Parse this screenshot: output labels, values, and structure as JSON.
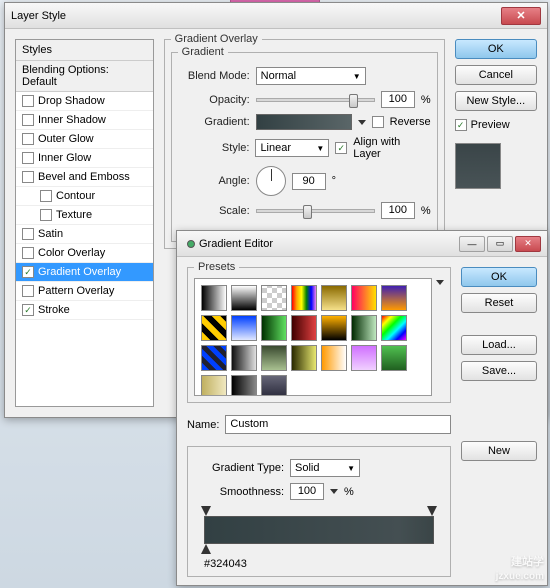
{
  "layerStyle": {
    "title": "Layer Style",
    "stylesHeader": "Styles",
    "blendingHeader": "Blending Options: Default",
    "items": [
      {
        "label": "Drop Shadow",
        "checked": false,
        "sub": false
      },
      {
        "label": "Inner Shadow",
        "checked": false,
        "sub": false
      },
      {
        "label": "Outer Glow",
        "checked": false,
        "sub": false
      },
      {
        "label": "Inner Glow",
        "checked": false,
        "sub": false
      },
      {
        "label": "Bevel and Emboss",
        "checked": false,
        "sub": false
      },
      {
        "label": "Contour",
        "checked": false,
        "sub": true
      },
      {
        "label": "Texture",
        "checked": false,
        "sub": true
      },
      {
        "label": "Satin",
        "checked": false,
        "sub": false
      },
      {
        "label": "Color Overlay",
        "checked": false,
        "sub": false
      },
      {
        "label": "Gradient Overlay",
        "checked": true,
        "sub": false,
        "selected": true
      },
      {
        "label": "Pattern Overlay",
        "checked": false,
        "sub": false
      },
      {
        "label": "Stroke",
        "checked": true,
        "sub": false
      }
    ],
    "buttons": {
      "ok": "OK",
      "cancel": "Cancel",
      "newStyle": "New Style...",
      "preview": "Preview"
    },
    "gradientOverlay": {
      "groupLabel": "Gradient Overlay",
      "subLabel": "Gradient",
      "blendModeLabel": "Blend Mode:",
      "blendMode": "Normal",
      "opacityLabel": "Opacity:",
      "opacity": "100",
      "opacityUnit": "%",
      "gradientLabel": "Gradient:",
      "reverse": "Reverse",
      "styleLabel": "Style:",
      "style": "Linear",
      "align": "Align with Layer",
      "angleLabel": "Angle:",
      "angle": "90",
      "angleUnit": "°",
      "scaleLabel": "Scale:",
      "scale": "100",
      "scaleUnit": "%"
    }
  },
  "gradientEditor": {
    "title": "Gradient Editor",
    "presetsLabel": "Presets",
    "nameLabel": "Name:",
    "name": "Custom",
    "typeLabel": "Gradient Type:",
    "type": "Solid",
    "smoothLabel": "Smoothness:",
    "smooth": "100",
    "smoothUnit": "%",
    "hex": "#324043",
    "buttons": {
      "ok": "OK",
      "reset": "Reset",
      "load": "Load...",
      "save": "Save...",
      "new": "New"
    },
    "presets": [
      "linear-gradient(to right,#000,#fff)",
      "linear-gradient(to bottom,#fff,#000)",
      "repeating-conic-gradient(#ccc 0 25%,#fff 0 50%) 0/10px 10px",
      "linear-gradient(to right,red,orange,yellow,green,blue,violet)",
      "linear-gradient(to bottom,#8a6a00,#f5e08a)",
      "linear-gradient(to right,#ff0060,#ffe000)",
      "linear-gradient(to bottom,#4020b0,#ff9a00)",
      "repeating-linear-gradient(45deg,#ffcc00 0 6px,#000 6px 12px)",
      "linear-gradient(to bottom,#0040ff,#e0e8ff)",
      "linear-gradient(to right,#003000,#60e060)",
      "linear-gradient(to right,#400000,#e04040)",
      "linear-gradient(to bottom,#ffb000,#000)",
      "linear-gradient(to right,#002a00,#bfe8bf)",
      "linear-gradient(135deg,red,yellow,lime,cyan,blue,magenta)",
      "repeating-linear-gradient(45deg,#0040ff 0 5px,#202030 5px 10px)",
      "linear-gradient(to right,#101010,#e0e0e0)",
      "linear-gradient(to bottom,#3a4a30,#a8c090)",
      "linear-gradient(to right,#2a2a00,#e8e870)",
      "linear-gradient(to right,#ff9a00,#fff)",
      "linear-gradient(to bottom,#d070ff,#f0d0ff)",
      "linear-gradient(to bottom,#50c050,#206020)",
      "linear-gradient(to right,#c0b060,#f0e8c0)",
      "linear-gradient(to right,#000,#888)",
      "linear-gradient(to bottom,#667,#223)"
    ]
  },
  "watermark": {
    "big": "建站学",
    "url": "jzxue.com"
  }
}
